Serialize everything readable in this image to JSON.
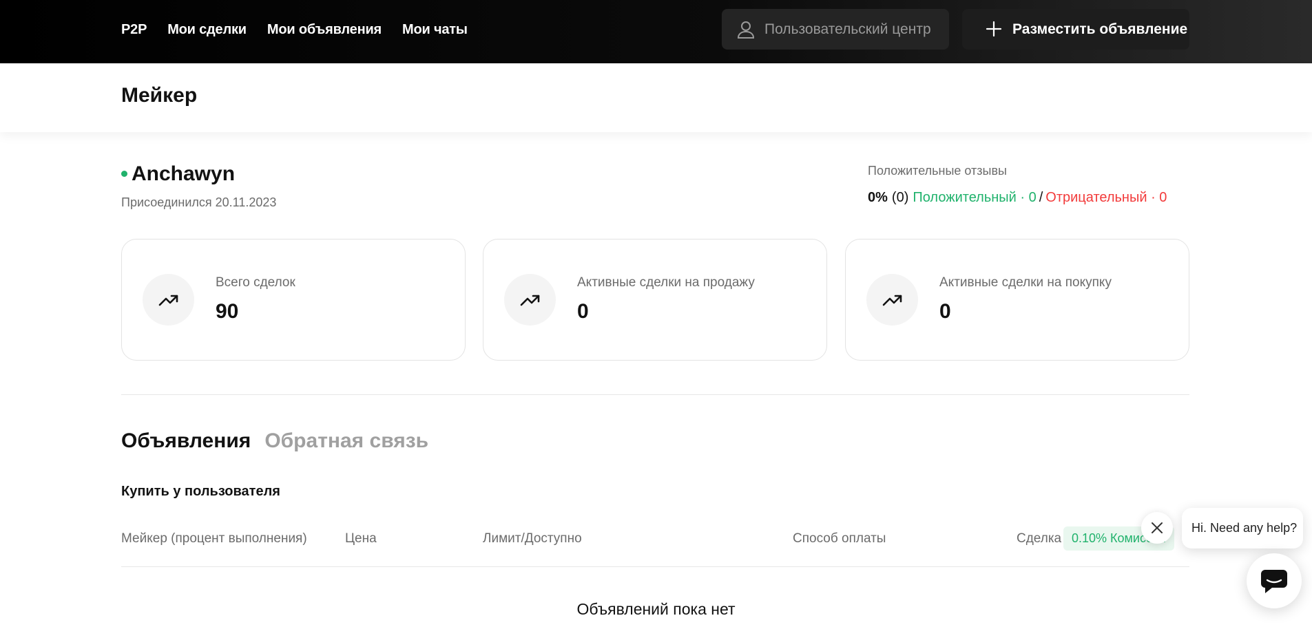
{
  "nav": {
    "items": [
      {
        "label": "P2P"
      },
      {
        "label": "Мои сделки"
      },
      {
        "label": "Мои объявления"
      },
      {
        "label": "Мои чаты"
      }
    ],
    "user_center_label": "Пользовательский центр",
    "post_ad_label": "Разместить объявление"
  },
  "page": {
    "title": "Мейкер"
  },
  "profile": {
    "name": "Anchawyn",
    "joined": "Присоединился 20.11.2023",
    "online_color": "#20b26c"
  },
  "feedback": {
    "label": "Положительные отзывы",
    "percent": "0%",
    "count": "(0)",
    "positive": "Положительный · 0",
    "separator": "/",
    "negative": "Отрицательный · 0"
  },
  "stats": [
    {
      "label": "Всего сделок",
      "value": "90",
      "icon": "trending-up-icon"
    },
    {
      "label": "Активные сделки на продажу",
      "value": "0",
      "icon": "trending-up-icon"
    },
    {
      "label": "Активные сделки на покупку",
      "value": "0",
      "icon": "trending-up-icon"
    }
  ],
  "tabs": [
    {
      "label": "Объявления",
      "active": true
    },
    {
      "label": "Обратная связь",
      "active": false
    }
  ],
  "section": {
    "title": "Купить у пользователя"
  },
  "table": {
    "columns": [
      "Мейкер (процент выполнения)",
      "Цена",
      "Лимит/Доступно",
      "Способ оплаты",
      "Сделка"
    ],
    "fee_badge": "0.10% Комиссия",
    "empty_text": "Объявлений пока нет"
  },
  "chat": {
    "greeting": "Hi. Need any help?"
  },
  "colors": {
    "accent_green": "#20b26c",
    "negative_red": "#f23a3a",
    "topbar": "#000000"
  }
}
